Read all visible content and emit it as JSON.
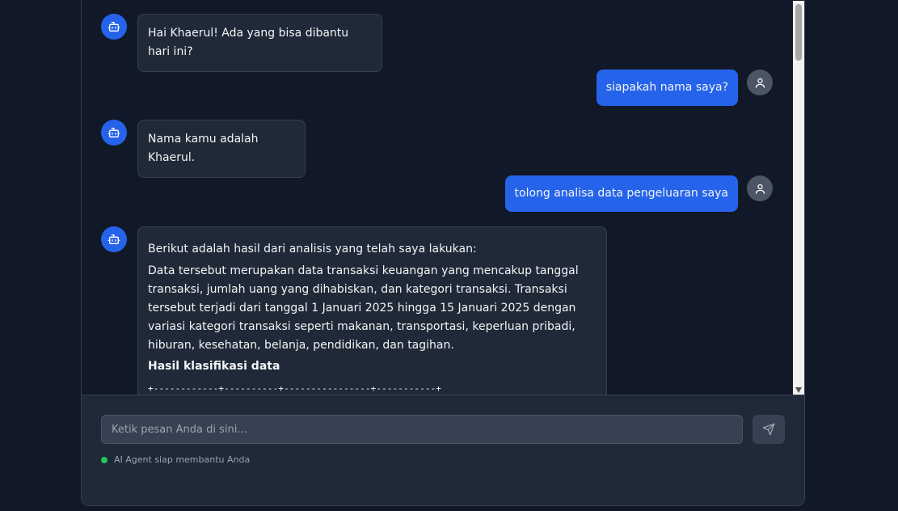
{
  "messages": [
    {
      "role": "bot",
      "text": "Hai Khaerul! Ada yang bisa dibantu hari ini?"
    },
    {
      "role": "user",
      "text": "siapakah nama saya?"
    },
    {
      "role": "bot",
      "text": "Nama kamu adalah Khaerul."
    },
    {
      "role": "user",
      "text": "tolong analisa data pengeluaran saya"
    },
    {
      "role": "bot",
      "intro": "Berikut adalah hasil dari analisis yang telah saya lakukan:",
      "body": "Data tersebut merupakan data transaksi keuangan yang mencakup tanggal transaksi, jumlah uang yang dihabiskan, dan kategori transaksi. Transaksi tersebut terjadi dari tanggal 1 Januari 2025 hingga 15 Januari 2025 dengan variasi kategori transaksi seperti makanan, transportasi, keperluan pribadi, hiburan, kesehatan, belanja, pendidikan, dan tagihan.",
      "heading": "Hasil klasifikasi data",
      "table_line": "+------------+----------+----------------+-----------+"
    }
  ],
  "input": {
    "placeholder": "Ketik pesan Anda di sini..."
  },
  "status": {
    "text": "AI Agent siap membantu Anda",
    "color": "#22c55e"
  },
  "icons": {
    "bot": "robot-icon",
    "user": "user-icon",
    "send": "send-icon"
  },
  "colors": {
    "accent": "#2563eb",
    "background": "#111827",
    "bubble": "#1f2937"
  }
}
